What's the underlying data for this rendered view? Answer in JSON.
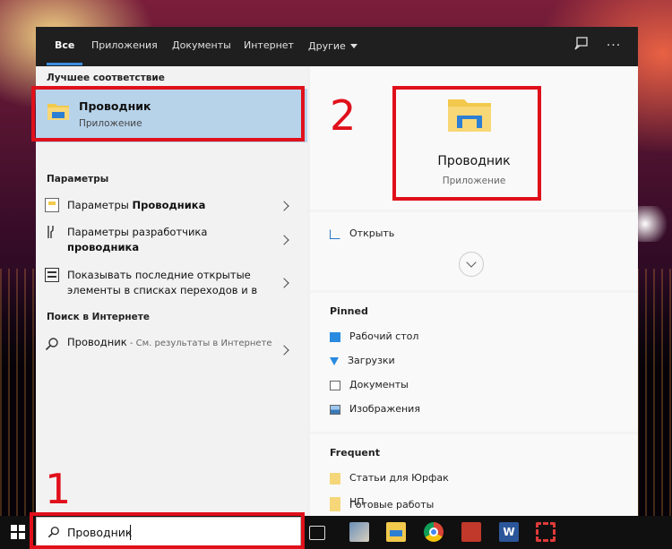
{
  "tabs": [
    {
      "label": "Все"
    },
    {
      "label": "Приложения"
    },
    {
      "label": "Документы"
    },
    {
      "label": "Интернет"
    },
    {
      "label": "Другие"
    }
  ],
  "left": {
    "best_match_header": "Лучшее соответствие",
    "best_match": {
      "title": "Проводник",
      "subtitle": "Приложение"
    },
    "settings_header": "Параметры",
    "settings": [
      {
        "text_pre": "Параметры ",
        "text_bold": "Проводника",
        "text_post": ""
      },
      {
        "text_pre": "Параметры разработчика",
        "text_bold": "проводника",
        "text_post": ""
      },
      {
        "text": "Показывать последние открытые элементы в списках переходов и в"
      }
    ],
    "web_header": "Поиск в Интернете",
    "web": {
      "title": "Проводник",
      "suffix": " - См. результаты в Интернете"
    }
  },
  "right": {
    "app_title": "Проводник",
    "app_subtitle": "Приложение",
    "open_label": "Открыть",
    "pinned_header": "Pinned",
    "pinned": [
      "Рабочий стол",
      "Загрузки",
      "Документы",
      "Изображения"
    ],
    "frequent_header": "Frequent",
    "frequent": [
      "Статьи для Юрфак",
      "НП",
      "Готовые работы"
    ]
  },
  "search": {
    "value": "Проводник"
  },
  "annotations": {
    "n1": "1",
    "n2": "2"
  },
  "colors": {
    "accent": "#3b8de0",
    "highlight": "#b7d3ea",
    "annotation": "#e0101b",
    "folder": "#f5d77a"
  }
}
